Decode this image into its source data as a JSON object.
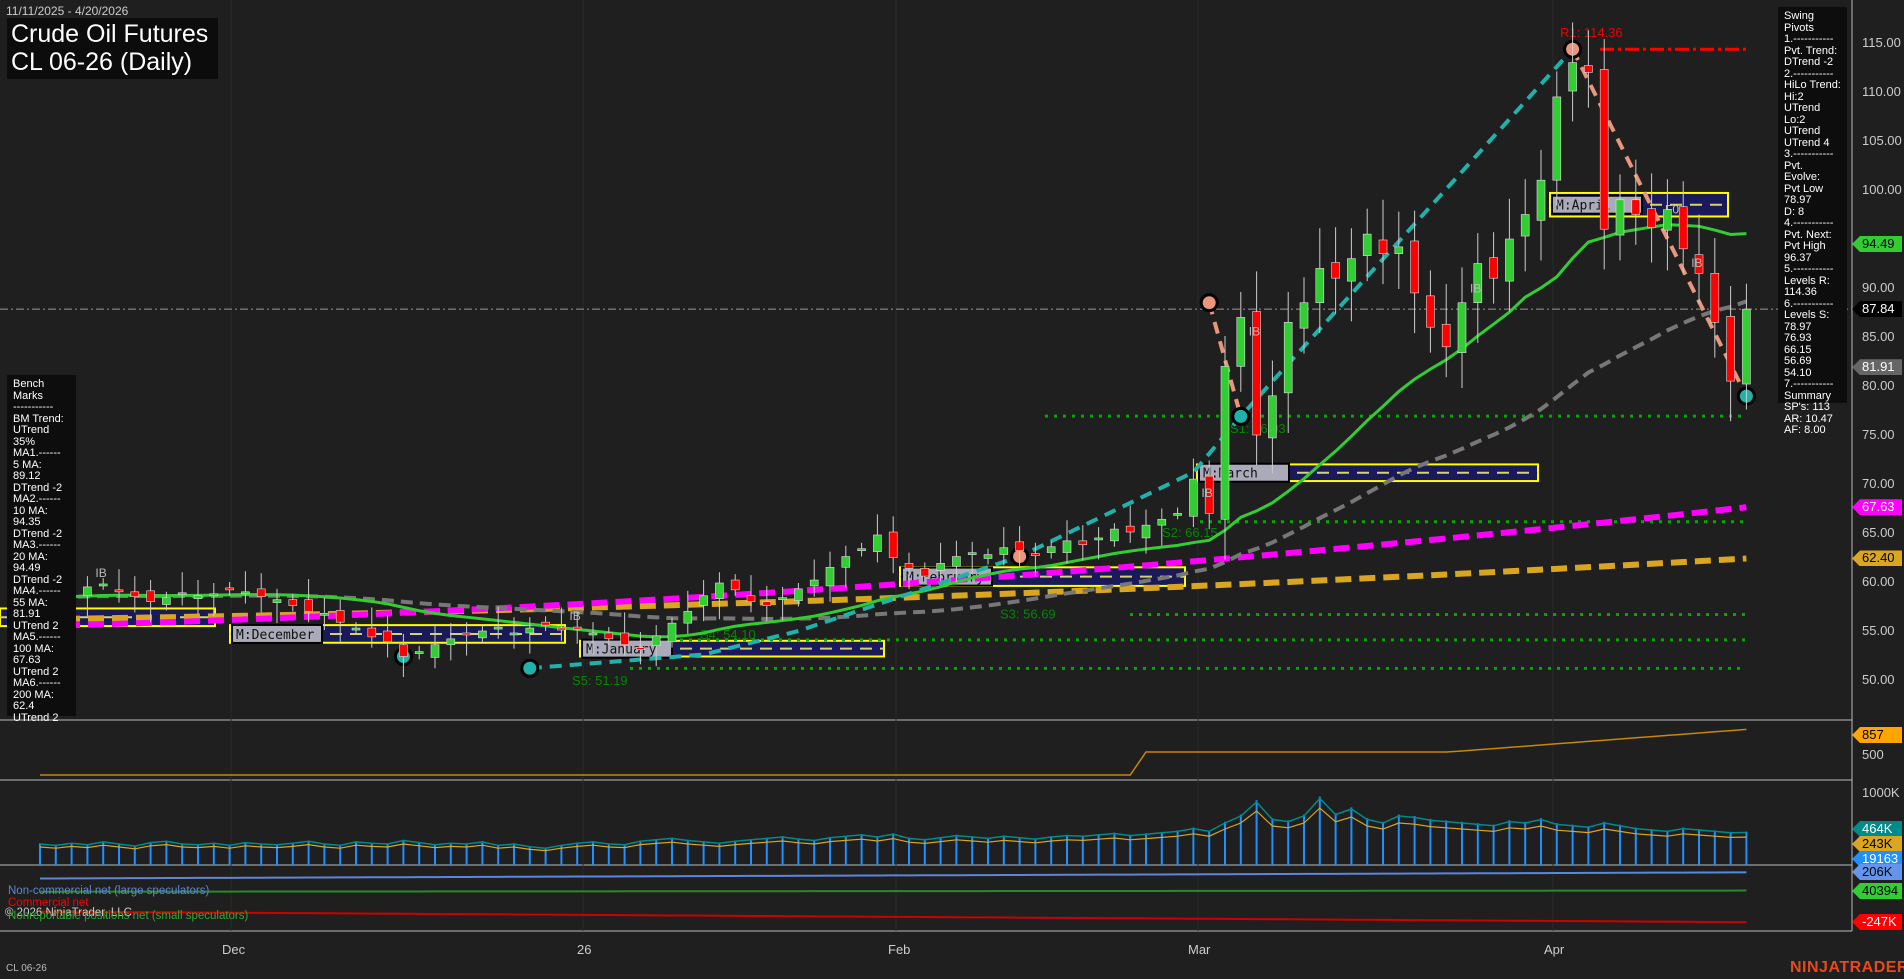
{
  "header": {
    "date_range": "11/11/2025 - 4/20/2026",
    "title": "Crude Oil Futures",
    "subtitle": "CL 06-26 (Daily)"
  },
  "swing_pivots": {
    "lines": [
      "Swing Pivots",
      "1.-----------",
      "Pvt. Trend:",
      "DTrend -2",
      "2.-----------",
      "HiLo Trend:",
      "Hi:2 UTrend",
      "Lo:2 UTrend",
      "UTrend 4",
      "3.-----------",
      "Pvt. Evolve:",
      "Pvt Low",
      "78.97",
      "D: 8",
      "4.-----------",
      "Pvt. Next:",
      "Pvt High",
      "96.37",
      "5.-----------",
      "Levels R:",
      "114.36",
      "6.-----------",
      "Levels S:",
      "78.97",
      "76.93",
      "66.15",
      "56.69",
      "54.10",
      "7.-----------",
      "Summary",
      "SP's: 113",
      "AR: 10.47",
      "AF: 8.00"
    ]
  },
  "bench_marks": {
    "lines": [
      "Bench Marks",
      "-----------",
      "BM Trend:",
      "UTrend 35%",
      "MA1.------",
      "5 MA:",
      "89.12",
      "DTrend -2",
      "MA2.------",
      "10 MA:",
      "94.35",
      "DTrend -2",
      "MA3.------",
      "20 MA:",
      "94.49",
      "DTrend -2",
      "MA4.------",
      "55 MA:",
      "81.91",
      "UTrend 2",
      "MA5.------",
      "100 MA:",
      "67.63",
      "UTrend 2",
      "MA6.------",
      "200 MA:",
      "62.4",
      "UTrend 2"
    ]
  },
  "price_axis": {
    "ticks": [
      "115.00",
      "110.00",
      "105.00",
      "100.00",
      "90.00",
      "85.00",
      "80.00",
      "75.00",
      "70.00",
      "65.00",
      "60.00",
      "55.00",
      "50.00"
    ]
  },
  "price_tags": [
    {
      "value": "94.49",
      "bg": "#33cc33",
      "fg": "#000000",
      "price": 94.49
    },
    {
      "value": "87.84",
      "bg": "#000000",
      "fg": "#ffffff",
      "price": 87.84
    },
    {
      "value": "81.91",
      "bg": "#666666",
      "fg": "#ffffff",
      "price": 81.91
    },
    {
      "value": "67.63",
      "bg": "#ff00ff",
      "fg": "#ffffff",
      "price": 67.63
    },
    {
      "value": "62.40",
      "bg": "#daa520",
      "fg": "#000000",
      "price": 62.4
    }
  ],
  "lower_axis": {
    "panel2_tick": "500",
    "panel3_tick": "1000K"
  },
  "lower_tags": [
    {
      "value": "857",
      "bg": "#ffa500",
      "fg": "#000"
    },
    {
      "value": "464K",
      "bg": "#008b8b",
      "fg": "#fff"
    },
    {
      "value": "243K",
      "bg": "#daa520",
      "fg": "#000"
    },
    {
      "value": "19163",
      "bg": "#1e90ff",
      "fg": "#fff"
    },
    {
      "value": "206K",
      "bg": "#6495ed",
      "fg": "#000"
    },
    {
      "value": "40394",
      "bg": "#32cd32",
      "fg": "#000"
    },
    {
      "value": "-247K",
      "bg": "#ff0000",
      "fg": "#fff"
    }
  ],
  "x_axis": {
    "labels": [
      "Dec",
      "26",
      "Feb",
      "Mar",
      "Apr"
    ]
  },
  "levels": {
    "r1": "R1: 114.36",
    "s1": "S1: 76.93",
    "s2": "S2: 66.15",
    "s3": "S3: 56.69",
    "s4": "S4: 54.10",
    "s5": "S5: 51.19",
    "f0": "F0",
    "ib": "IB"
  },
  "months": [
    "M:December",
    "M:January",
    "M:February",
    "M:March",
    "M:April"
  ],
  "legend": {
    "noncommercial": "Non-commercial net (large speculators)",
    "commercial": "Commercial net",
    "nonreportable": "Nonreportable positions net (small speculators)",
    "copyright": "© 2026 NinjaTrader, LLC"
  },
  "footer": {
    "symbol": "CL 06-26",
    "brand": "NINJATRADER"
  },
  "chart_data": {
    "type": "candlestick",
    "title": "CL 06-26 (Daily)",
    "ylim": [
      48,
      117
    ],
    "closes": [
      58.5,
      58.2,
      58.9,
      59.5,
      59.8,
      59.0,
      58.5,
      58.0,
      58.4,
      58.9,
      58.6,
      58.8,
      59.2,
      59.0,
      58.5,
      58.2,
      57.6,
      57.0,
      56.8,
      55.9,
      55.3,
      54.4,
      53.9,
      52.4,
      52.9,
      53.6,
      54.2,
      54.6,
      55.0,
      55.4,
      54.8,
      55.3,
      55.6,
      55.1,
      55.3,
      54.8,
      54.2,
      53.6,
      53.2,
      54.5,
      55.8,
      57.0,
      58.6,
      59.9,
      59.2,
      58.0,
      57.6,
      58.4,
      59.3,
      60.2,
      61.5,
      62.6,
      63.4,
      64.8,
      62.5,
      61.4,
      60.6,
      61.9,
      62.6,
      63.0,
      62.8,
      63.5,
      63.2,
      62.7,
      63.6,
      64.2,
      63.8,
      64.5,
      65.4,
      65.1,
      65.8,
      66.4,
      67.0,
      70.5,
      67.0,
      82.0,
      87.0,
      75.0,
      79.0,
      86.5,
      88.5,
      92.0,
      91.0,
      93.0,
      95.5,
      93.5,
      94.2,
      89.5,
      86.0,
      84.0,
      88.5,
      92.5,
      91.0,
      95.0,
      97.5,
      101.0,
      109.5,
      113.0,
      112.0,
      96.0,
      99.0,
      97.5,
      96.2,
      98.0,
      94.0,
      91.5,
      86.5,
      80.5,
      87.84
    ],
    "ma100": [
      55.5,
      67.63
    ],
    "ma200": [
      56.2,
      62.4
    ],
    "last": 87.84,
    "r1": 114.36,
    "supports": [
      76.93,
      66.15,
      56.69,
      54.1,
      51.19
    ],
    "volume_k": [
      300,
      280,
      310,
      290,
      330,
      300,
      270,
      320,
      340,
      300,
      290,
      310,
      280,
      320,
      300,
      290,
      310,
      340,
      300,
      280,
      330,
      310,
      300,
      350,
      320,
      290,
      310,
      300,
      330,
      280,
      300,
      260,
      240,
      280,
      310,
      330,
      300,
      290,
      340,
      360,
      380,
      350,
      330,
      310,
      340,
      360,
      380,
      400,
      370,
      350,
      390,
      410,
      430,
      400,
      440,
      380,
      360,
      390,
      420,
      400,
      380,
      410,
      390,
      370,
      400,
      420,
      410,
      430,
      450,
      420,
      440,
      460,
      480,
      520,
      480,
      600,
      700,
      900,
      650,
      620,
      700,
      950,
      720,
      800,
      650,
      600,
      700,
      680,
      640,
      620,
      600,
      580,
      560,
      620,
      600,
      650,
      580,
      560,
      540,
      600,
      560,
      520,
      500,
      480,
      520,
      500,
      480,
      460,
      464
    ],
    "cot_k": {
      "noncommercial": [
        150,
        206
      ],
      "commercial": [
        -150,
        -247
      ],
      "nonreportable": [
        30,
        40.4
      ]
    }
  }
}
